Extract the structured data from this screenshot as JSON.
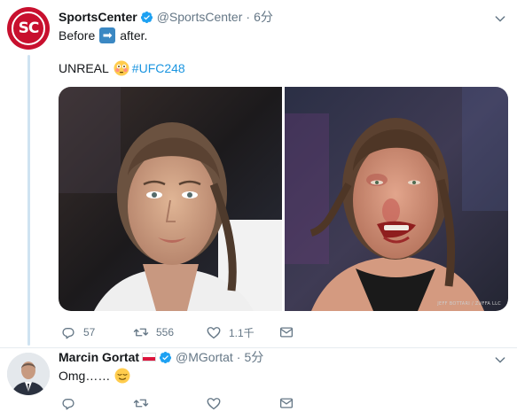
{
  "tweet": {
    "author_name": "SportsCenter",
    "author_handle": "@SportsCenter",
    "separator": "·",
    "time": "6分",
    "avatar_text": "SC",
    "text_before": "Before",
    "arrow_glyph": "➡",
    "text_after": "after.",
    "text_line2": "UNREAL",
    "hashtag": "#UFC248",
    "photo_credit": "JEFF BOTTARI / ZUFFA LLC",
    "stats": {
      "replies": "57",
      "retweets": "556",
      "likes": "1.1千"
    }
  },
  "reply": {
    "author_name": "Marcin Gortat",
    "author_handle": "@MGortat",
    "separator": "·",
    "time": "5分",
    "text": "Omg……"
  },
  "colors": {
    "verified": "#1da1f2",
    "link": "#1b95e0",
    "muted": "#657786",
    "thread_line": "#cfe3f1",
    "brand_red": "#c8102e"
  },
  "icons": [
    "verified-icon",
    "chevron-down-icon",
    "reply-icon",
    "retweet-icon",
    "like-icon",
    "dm-icon",
    "arrow-right-icon",
    "flushed-face-icon",
    "relieved-face-icon"
  ]
}
